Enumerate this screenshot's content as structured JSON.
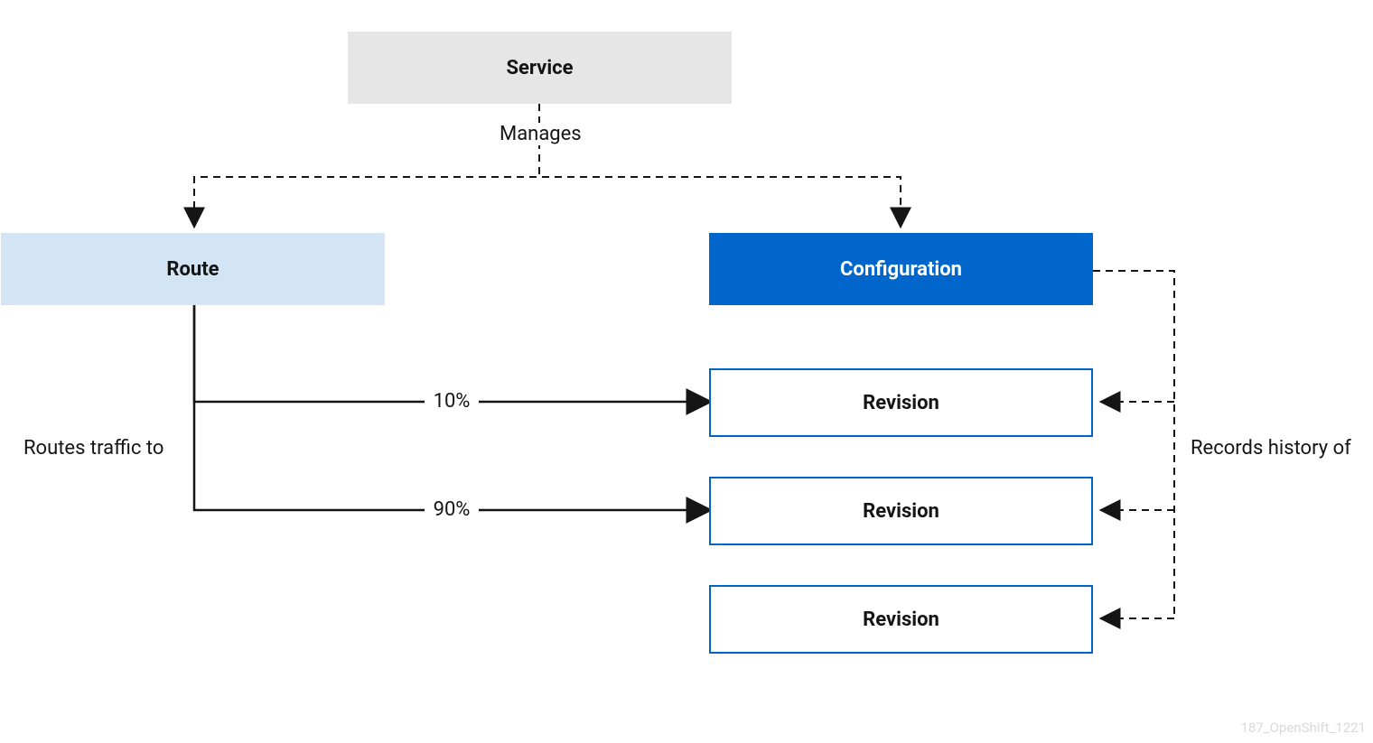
{
  "colors": {
    "service_bg": "#e6e6e6",
    "route_bg": "#d3e5f5",
    "config_bg": "#0066cc",
    "config_fg": "#ffffff",
    "revision_border": "#0066cc",
    "text": "#151515",
    "watermark": "#d9d9d9"
  },
  "nodes": {
    "service": "Service",
    "route": "Route",
    "configuration": "Configuration",
    "revision1": "Revision",
    "revision2": "Revision",
    "revision3": "Revision"
  },
  "edges": {
    "service_manages": "Manages",
    "routes_traffic": "Routes traffic to",
    "records_history": "Records history of",
    "split_10": "10%",
    "split_90": "90%"
  },
  "watermark": "187_OpenShift_1221"
}
